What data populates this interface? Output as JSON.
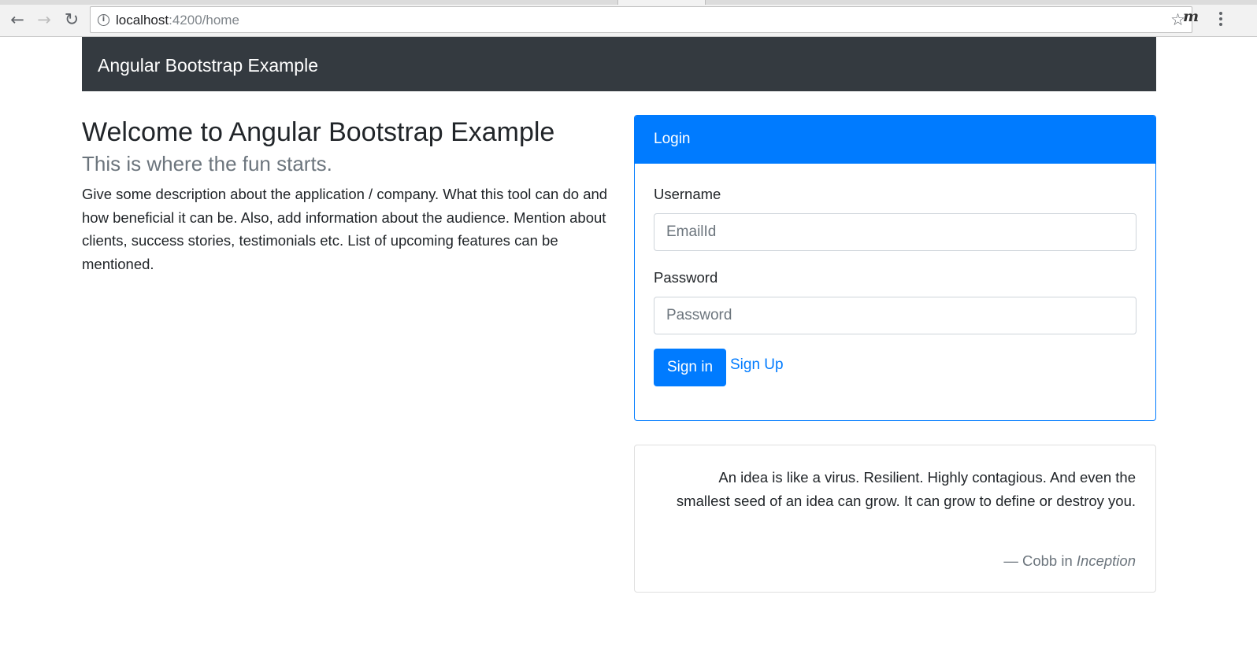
{
  "browser": {
    "url_host": "localhost",
    "url_path": ":4200/home",
    "icons": {
      "back": "back-arrow-icon",
      "forward": "forward-arrow-icon",
      "reload": "reload-icon",
      "info": "info-icon",
      "bookmark": "star-icon",
      "extension": "extension-m-icon",
      "menu": "kebab-menu-icon"
    },
    "extension_glyph": "m"
  },
  "navbar": {
    "brand": "Angular Bootstrap Example",
    "background": "#343a40"
  },
  "hero": {
    "title": "Welcome to Angular Bootstrap Example",
    "subtitle": "This is where the fun starts.",
    "description": "Give some description about the application / company. What this tool can do and how beneficial it can be. Also, add information about the audience. Mention about clients, success stories, testimonials etc. List of upcoming features can be mentioned."
  },
  "login": {
    "header": "Login",
    "username_label": "Username",
    "username_placeholder": "EmailId",
    "username_value": "",
    "password_label": "Password",
    "password_placeholder": "Password",
    "password_value": "",
    "signin_label": "Sign in",
    "signup_label": "Sign Up",
    "accent": "#007bff"
  },
  "quote": {
    "text": "An idea is like a virus. Resilient. Highly contagious. And even the smallest seed of an idea can grow. It can grow to define or destroy you.",
    "attribution_prefix": "— Cobb in ",
    "attribution_source": "Inception"
  }
}
